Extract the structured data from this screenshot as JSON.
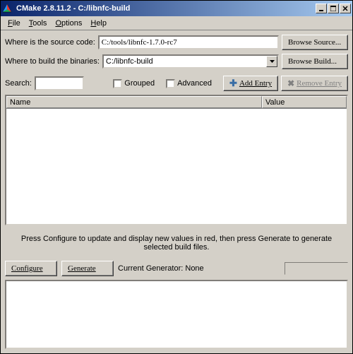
{
  "title": "CMake 2.8.11.2 - C:/libnfc-build",
  "menu": {
    "file": "File",
    "tools": "Tools",
    "options": "Options",
    "help": "Help"
  },
  "labels": {
    "source": "Where is the source code:",
    "build": "Where to build the binaries:",
    "search": "Search:",
    "grouped": "Grouped",
    "advanced": "Advanced",
    "current_gen": "Current Generator: None"
  },
  "values": {
    "source_path": "C:/tools/libnfc-1.7.0-rc7",
    "build_path": "C:/libnfc-build"
  },
  "buttons": {
    "browse_source": "Browse Source...",
    "browse_build": "Browse Build...",
    "add_entry": "Add Entry",
    "remove_entry": "Remove Entry",
    "configure": "Configure",
    "generate": "Generate"
  },
  "table": {
    "name": "Name",
    "value": "Value"
  },
  "hint": "Press Configure to update and display new values in red, then press Generate to generate selected build files."
}
